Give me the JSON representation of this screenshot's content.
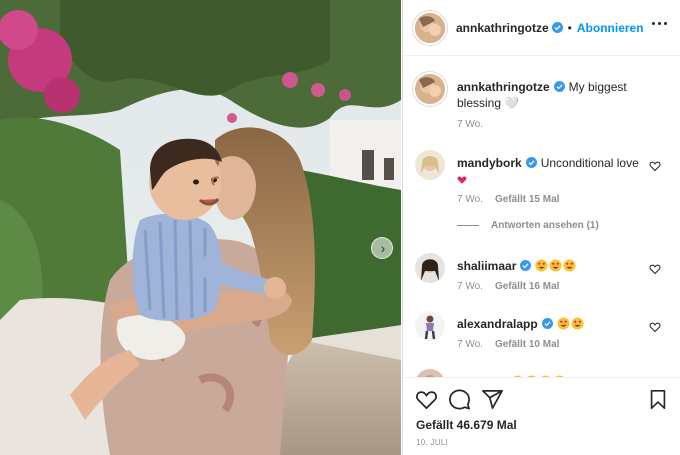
{
  "post": {
    "username": "annkathringotze",
    "dot": "•",
    "follow_label": "Abonnieren",
    "caption": "My biggest blessing 🤍",
    "caption_age": "7 Wo.",
    "likes_total": "Gefällt 46.679 Mal",
    "date": "10. JULI"
  },
  "comments": [
    {
      "username": "mandybork",
      "text": "Unconditional love",
      "emojis": [
        "heart-red"
      ],
      "age": "7 Wo.",
      "likes": "Gefällt 15 Mal",
      "replies_label": "Antworten ansehen (1)"
    },
    {
      "username": "shaliimaar",
      "text": "",
      "emojis": [
        "heart-eyes",
        "heart-eyes",
        "heart-eyes"
      ],
      "age": "7 Wo.",
      "likes": "Gefällt 16 Mal"
    },
    {
      "username": "alexandralapp",
      "text": "",
      "emojis": [
        "heart-eyes",
        "heart-eyes"
      ],
      "age": "7 Wo.",
      "likes": "Gefällt 10 Mal"
    },
    {
      "username": "",
      "text": "",
      "emojis": [
        "heart-eyes",
        "heart-eyes",
        "heart-eyes",
        "heart-eyes"
      ],
      "age": "",
      "likes": ""
    }
  ],
  "icons": {
    "verified": "verified-badge-icon",
    "more": "more-options-icon",
    "like": "heart-icon",
    "comment": "comment-icon",
    "share": "share-icon",
    "save": "bookmark-icon",
    "carousel": "chevron-right-icon"
  },
  "colors": {
    "link": "#0095f6",
    "verified": "#3897f0",
    "text": "#262626",
    "secondary": "#8e8e8e"
  }
}
